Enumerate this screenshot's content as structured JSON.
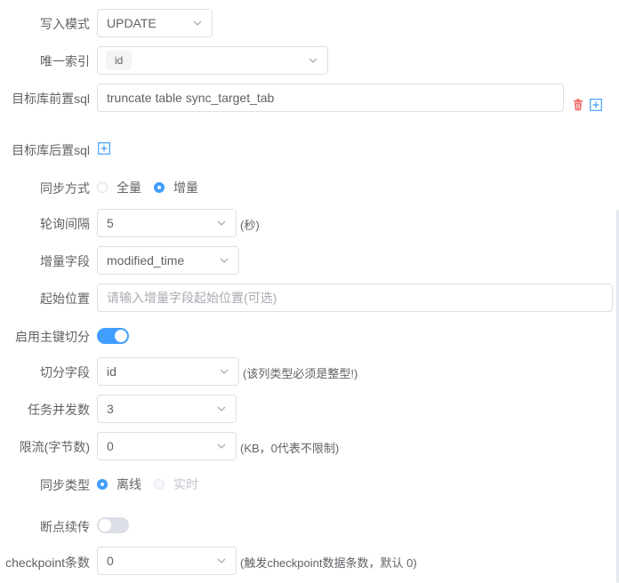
{
  "form": {
    "write_mode": {
      "label": "写入模式",
      "value": "UPDATE"
    },
    "unique_index": {
      "label": "唯一索引",
      "tag": "id"
    },
    "target_pre_sql": {
      "label": "目标库前置sql",
      "value": "truncate table sync_target_tab"
    },
    "target_post_sql": {
      "label": "目标库后置sql"
    },
    "sync_mode": {
      "label": "同步方式",
      "options": [
        "全量",
        "增量"
      ],
      "selected": "增量"
    },
    "poll_interval": {
      "label": "轮询间隔",
      "value": "5",
      "suffix": "(秒)"
    },
    "incremental_field": {
      "label": "增量字段",
      "value": "modified_time"
    },
    "start_position": {
      "label": "起始位置",
      "placeholder": "请输入增量字段起始位置(可选)"
    },
    "enable_pk_split": {
      "label": "启用主键切分",
      "on": true
    },
    "split_field": {
      "label": "切分字段",
      "value": "id",
      "suffix": "(该列类型必须是整型!)"
    },
    "task_concurrency": {
      "label": "任务并发数",
      "value": "3"
    },
    "rate_limit": {
      "label": "限流(字节数)",
      "value": "0",
      "suffix": "(KB，0代表不限制)"
    },
    "sync_type": {
      "label": "同步类型",
      "options": [
        "离线",
        "实时"
      ],
      "selected": "离线"
    },
    "resume_from_break": {
      "label": "断点续传",
      "on": false
    },
    "checkpoint_count": {
      "label": "checkpoint条数",
      "value": "0",
      "suffix": "(触发checkpoint数据条数，默认 0)"
    }
  },
  "colors": {
    "accent": "#409eff",
    "delete": "#f56c6c",
    "border": "#dcdfe6",
    "text": "#606266",
    "placeholder": "#a8abb2"
  },
  "icons": {
    "caret": "chevron-down-icon",
    "add": "plus-square-icon",
    "delete": "trash-icon"
  }
}
